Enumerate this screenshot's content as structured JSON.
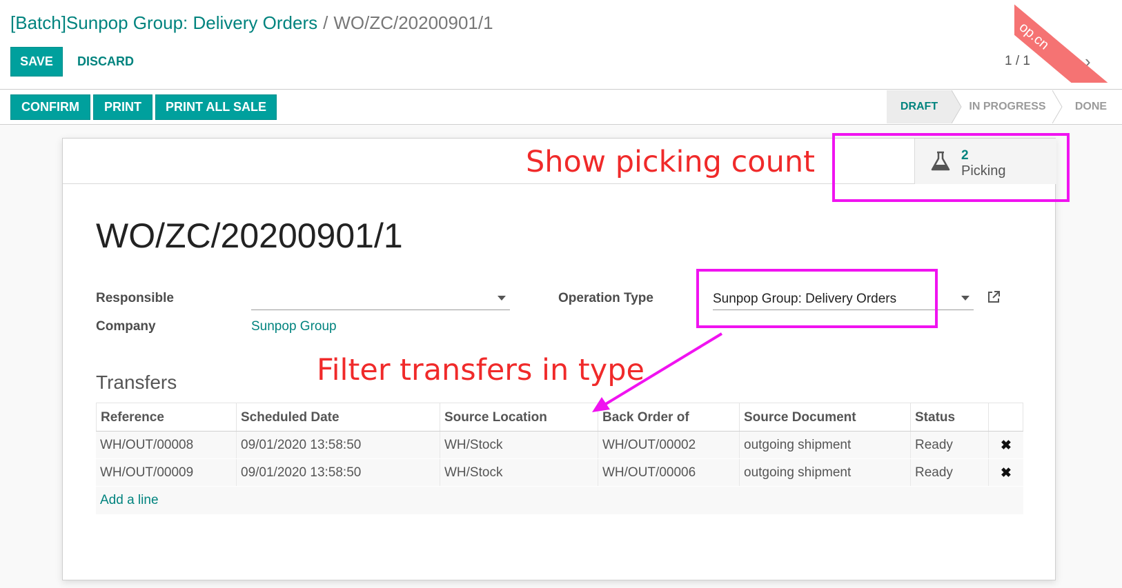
{
  "breadcrumb": {
    "parent": "[Batch]Sunpop Group: Delivery Orders",
    "separator": "/",
    "current": "WO/ZC/20200901/1"
  },
  "controls": {
    "save_label": "SAVE",
    "discard_label": "DISCARD"
  },
  "pager": {
    "value": "1 / 1"
  },
  "header_buttons": {
    "confirm": "CONFIRM",
    "print": "PRINT",
    "print_all_sale": "PRINT ALL SALE"
  },
  "status_stages": [
    {
      "label": "DRAFT",
      "active": true
    },
    {
      "label": "IN PROGRESS",
      "active": false
    },
    {
      "label": "DONE",
      "active": false
    }
  ],
  "smart_button": {
    "count": "2",
    "label": "Picking",
    "icon": "flask-icon"
  },
  "record": {
    "name": "WO/ZC/20200901/1",
    "fields": {
      "responsible_label": "Responsible",
      "responsible_value": "",
      "company_label": "Company",
      "company_value": "Sunpop Group",
      "operation_type_label": "Operation Type",
      "operation_type_value": "Sunpop Group: Delivery Orders"
    }
  },
  "transfers": {
    "title": "Transfers",
    "columns": [
      "Reference",
      "Scheduled Date",
      "Source Location",
      "Back Order of",
      "Source Document",
      "Status"
    ],
    "rows": [
      [
        "WH/OUT/00008",
        "09/01/2020 13:58:50",
        "WH/Stock",
        "WH/OUT/00002",
        "outgoing shipment",
        "Ready"
      ],
      [
        "WH/OUT/00009",
        "09/01/2020 13:58:50",
        "WH/Stock",
        "WH/OUT/00006",
        "outgoing shipment",
        "Ready"
      ]
    ],
    "delete_glyph": "✖",
    "add_line": "Add a line"
  },
  "annotations": {
    "picking": "Show picking count",
    "filter": "Filter transfers in type"
  },
  "watermark": {
    "text": "op.cn"
  },
  "colors": {
    "primary": "#00a09d",
    "link": "#00837e",
    "annotation": "#f02a2a",
    "highlight": "#f013f0"
  }
}
